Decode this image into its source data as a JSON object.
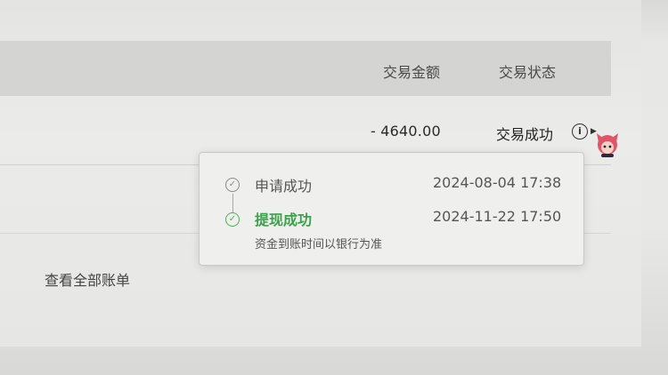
{
  "table": {
    "headers": {
      "amount": "交易金额",
      "status": "交易状态"
    },
    "row": {
      "amount": "- 4640.00",
      "status": "交易成功"
    }
  },
  "icons": {
    "info": "i",
    "caret": "▶",
    "check": "✓"
  },
  "popover": {
    "steps": [
      {
        "label": "申请成功",
        "time": "2024-08-04 17:38",
        "state": "done"
      },
      {
        "label": "提现成功",
        "time": "2024-11-22 17:50",
        "state": "success",
        "note": "资金到账时间以银行为准"
      }
    ]
  },
  "footer": {
    "view_all": "查看全部账单"
  },
  "colors": {
    "success": "#3aa24a",
    "header_bg": "#d4d4d2"
  }
}
